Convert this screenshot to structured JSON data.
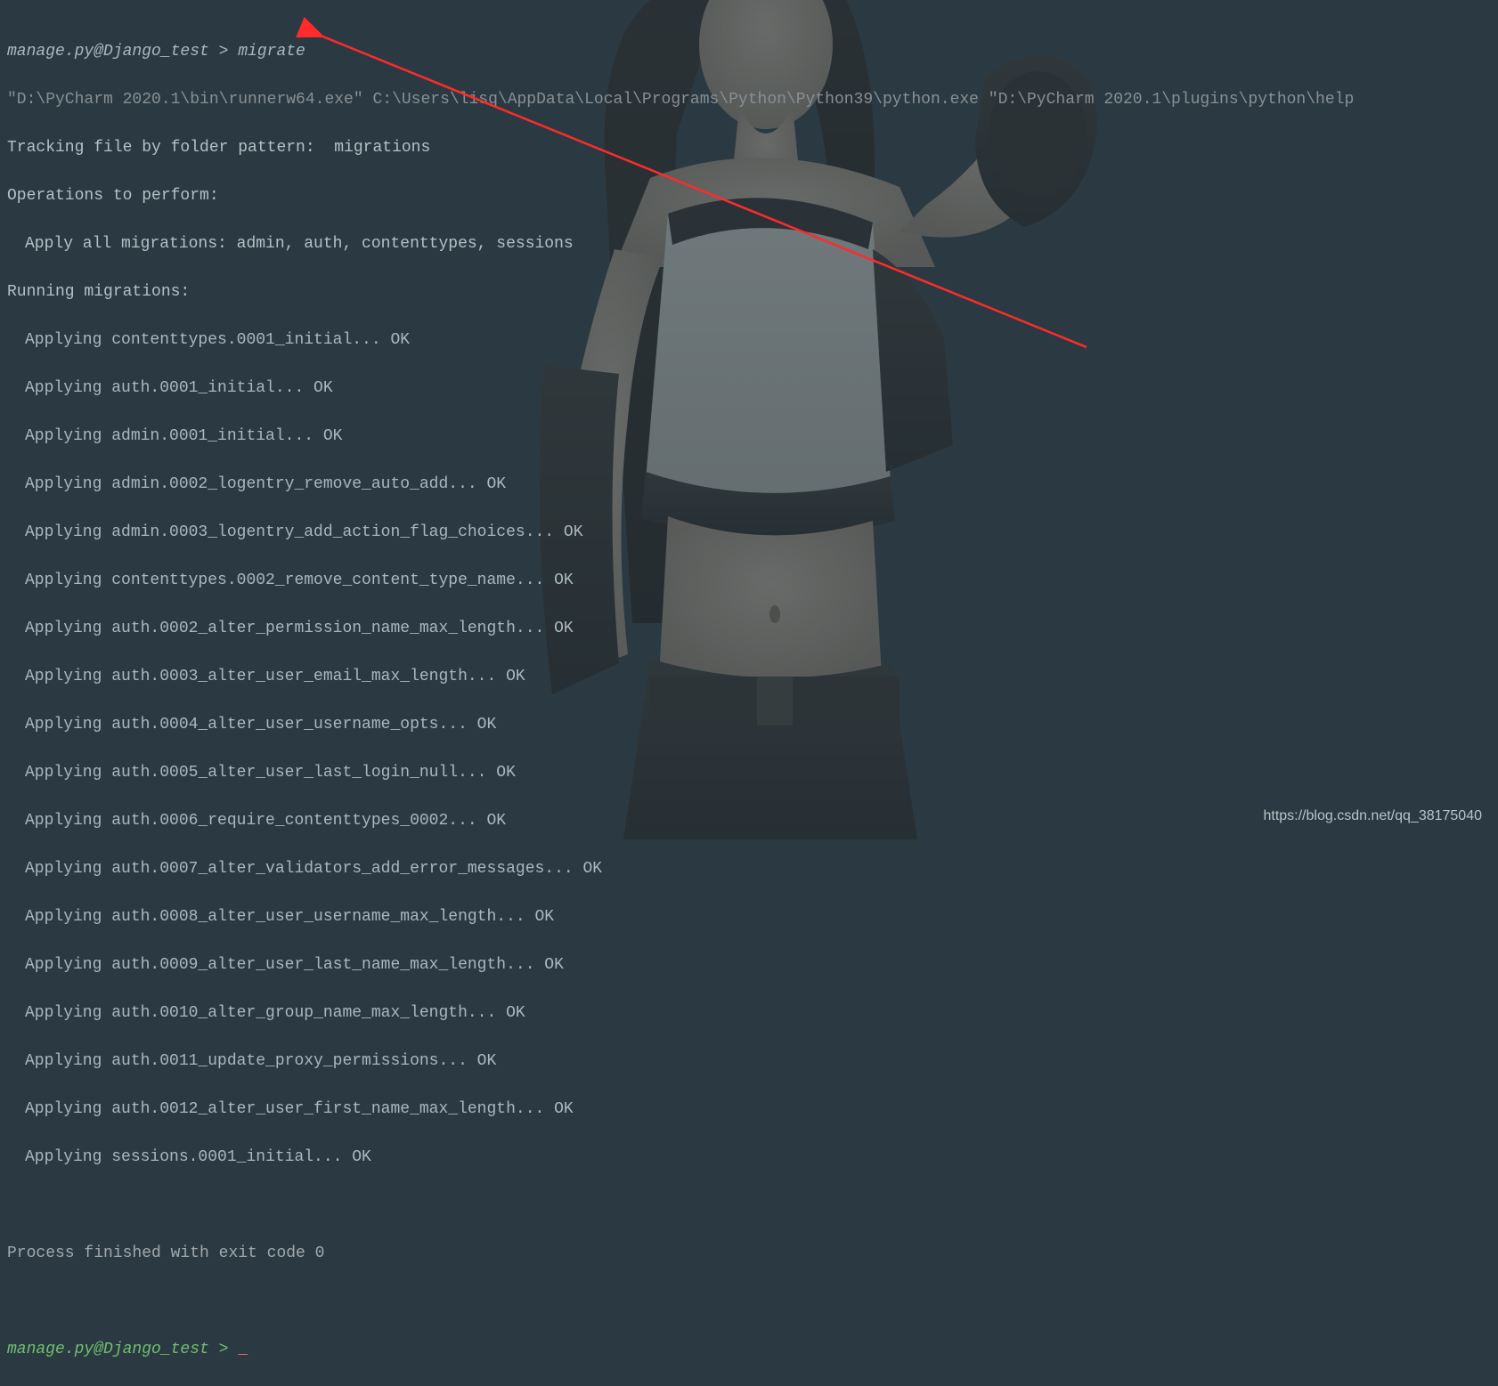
{
  "prompt": {
    "prefix": "manage.py@Django_test > ",
    "command": "migrate"
  },
  "exec_path": "\"D:\\PyCharm 2020.1\\bin\\runnerw64.exe\" C:\\Users\\lisq\\AppData\\Local\\Programs\\Python\\Python39\\python.exe \"D:\\PyCharm 2020.1\\plugins\\python\\help",
  "tracking": "Tracking file by folder pattern:  migrations",
  "operations_header": "Operations to perform:",
  "apply_all": "Apply all migrations: admin, auth, contenttypes, sessions",
  "running_header": "Running migrations:",
  "migrations": [
    "Applying contenttypes.0001_initial... OK",
    "Applying auth.0001_initial... OK",
    "Applying admin.0001_initial... OK",
    "Applying admin.0002_logentry_remove_auto_add... OK",
    "Applying admin.0003_logentry_add_action_flag_choices... OK",
    "Applying contenttypes.0002_remove_content_type_name... OK",
    "Applying auth.0002_alter_permission_name_max_length... OK",
    "Applying auth.0003_alter_user_email_max_length... OK",
    "Applying auth.0004_alter_user_username_opts... OK",
    "Applying auth.0005_alter_user_last_login_null... OK",
    "Applying auth.0006_require_contenttypes_0002... OK",
    "Applying auth.0007_alter_validators_add_error_messages... OK",
    "Applying auth.0008_alter_user_username_max_length... OK",
    "Applying auth.0009_alter_user_last_name_max_length... OK",
    "Applying auth.0010_alter_group_name_max_length... OK",
    "Applying auth.0011_update_proxy_permissions... OK",
    "Applying auth.0012_alter_user_first_name_max_length... OK",
    "Applying sessions.0001_initial... OK"
  ],
  "finish": "Process finished with exit code 0",
  "new_prompt": "manage.py@Django_test > ",
  "cursor": "_",
  "watermark": "https://blog.csdn.net/qq_38175040"
}
